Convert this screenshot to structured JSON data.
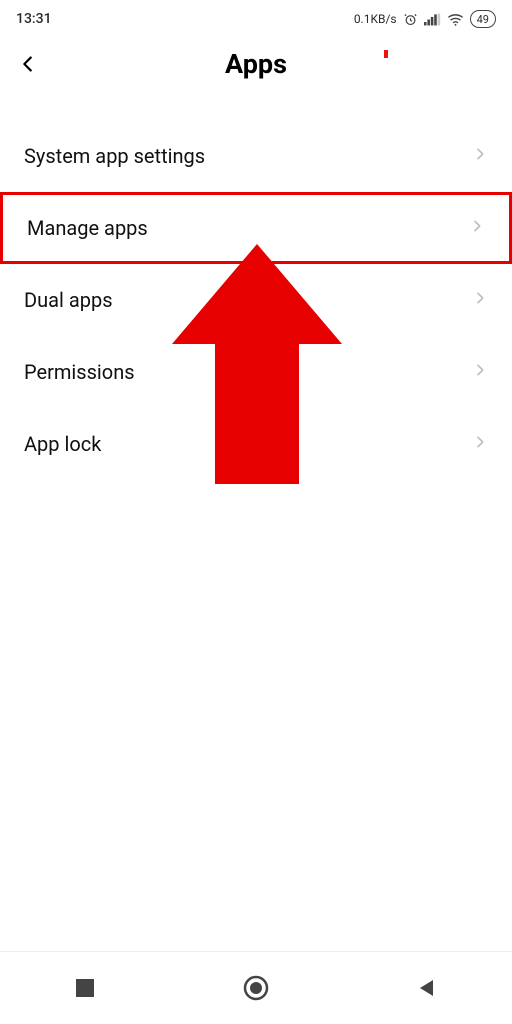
{
  "status": {
    "time": "13:31",
    "net_speed": "0.1KB/s",
    "battery": "49"
  },
  "header": {
    "title": "Apps"
  },
  "list": {
    "items": [
      {
        "label": "System app settings",
        "highlight": false
      },
      {
        "label": "Manage apps",
        "highlight": true
      },
      {
        "label": "Dual apps",
        "highlight": false
      },
      {
        "label": "Permissions",
        "highlight": false
      },
      {
        "label": "App lock",
        "highlight": false
      }
    ]
  },
  "annotation": {
    "type": "red-up-arrow",
    "target": "list.items.1"
  },
  "colors": {
    "highlight": "#e60000",
    "chevron": "#bdbdbd"
  }
}
